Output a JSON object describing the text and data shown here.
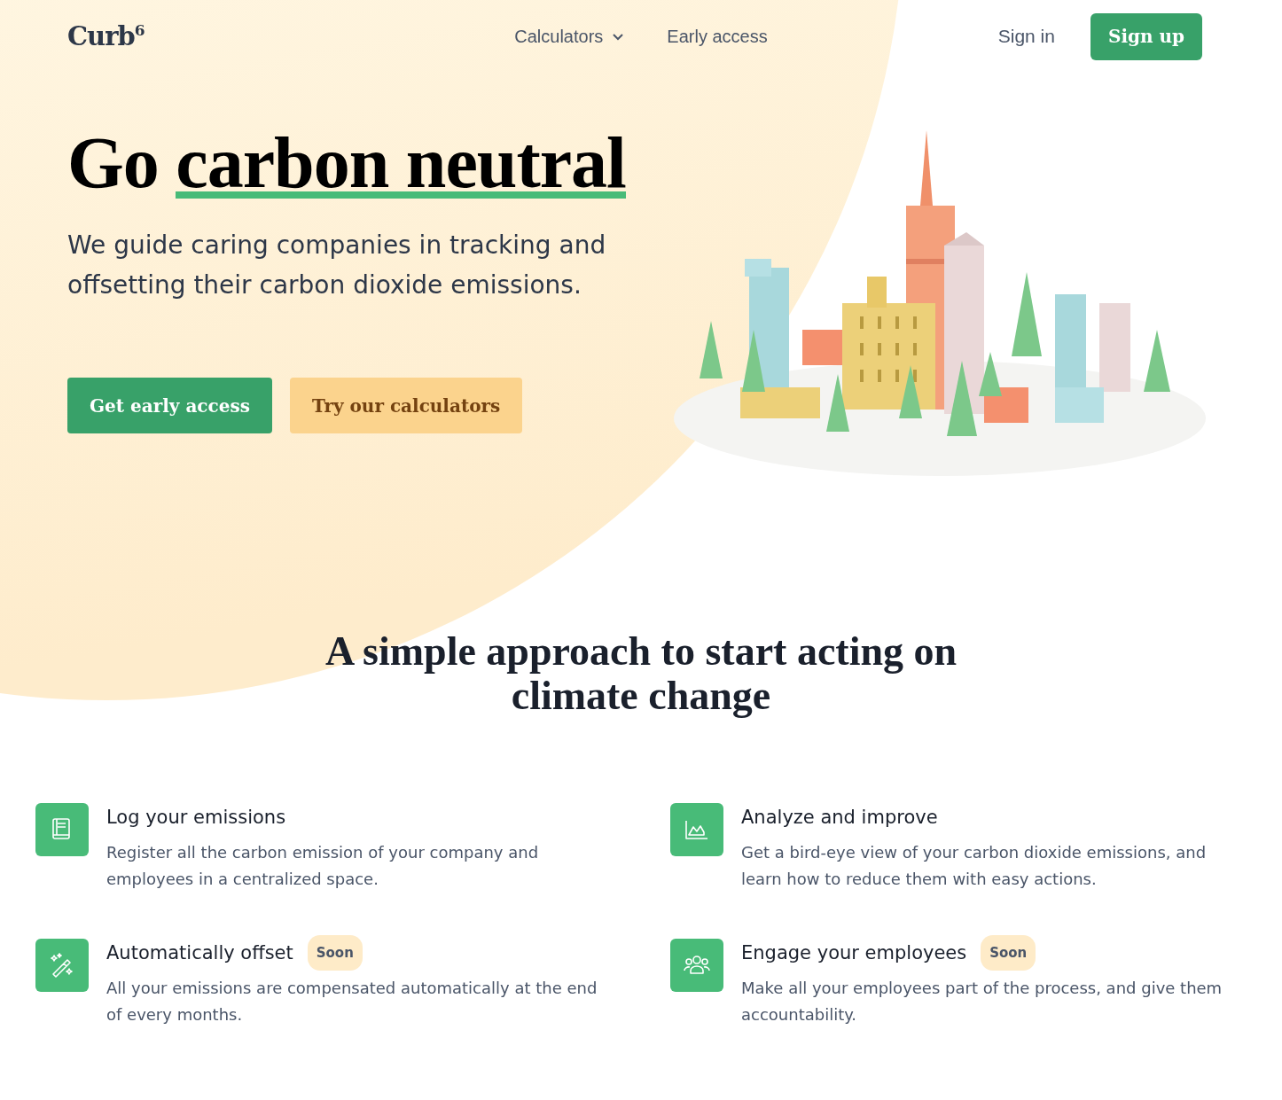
{
  "header": {
    "logo": "Curb",
    "logo_sup": "6",
    "nav": [
      {
        "label": "Calculators",
        "dropdown": true
      },
      {
        "label": "Early access",
        "dropdown": false
      }
    ],
    "sign_in": "Sign in",
    "sign_up": "Sign up"
  },
  "hero": {
    "title_plain": "Go ",
    "title_underlined": "carbon neutral",
    "subtitle": "We guide caring companies in tracking and offsetting their carbon dioxide emissions.",
    "buttons": [
      {
        "label": "Get early access",
        "kind": "primary"
      },
      {
        "label": "Try our calculators",
        "kind": "secondary"
      }
    ]
  },
  "section": {
    "heading": "A simple approach to start acting on climate change"
  },
  "features": [
    {
      "title": "Log your emissions",
      "text": "Register all the carbon emission of your company and employees in a centralized space."
    },
    {
      "title": "Analyze and improve",
      "text": "Get a bird-eye view of your carbon dioxide emissions, and learn how to reduce them with easy actions."
    },
    {
      "title": "Automatically offset",
      "badge": "Soon",
      "text": "All your emissions are compensated automatically at the end of every months."
    },
    {
      "title": "Engage your employees",
      "badge": "Soon",
      "text": "Make all your employees part of the process, and give them accountability."
    }
  ]
}
